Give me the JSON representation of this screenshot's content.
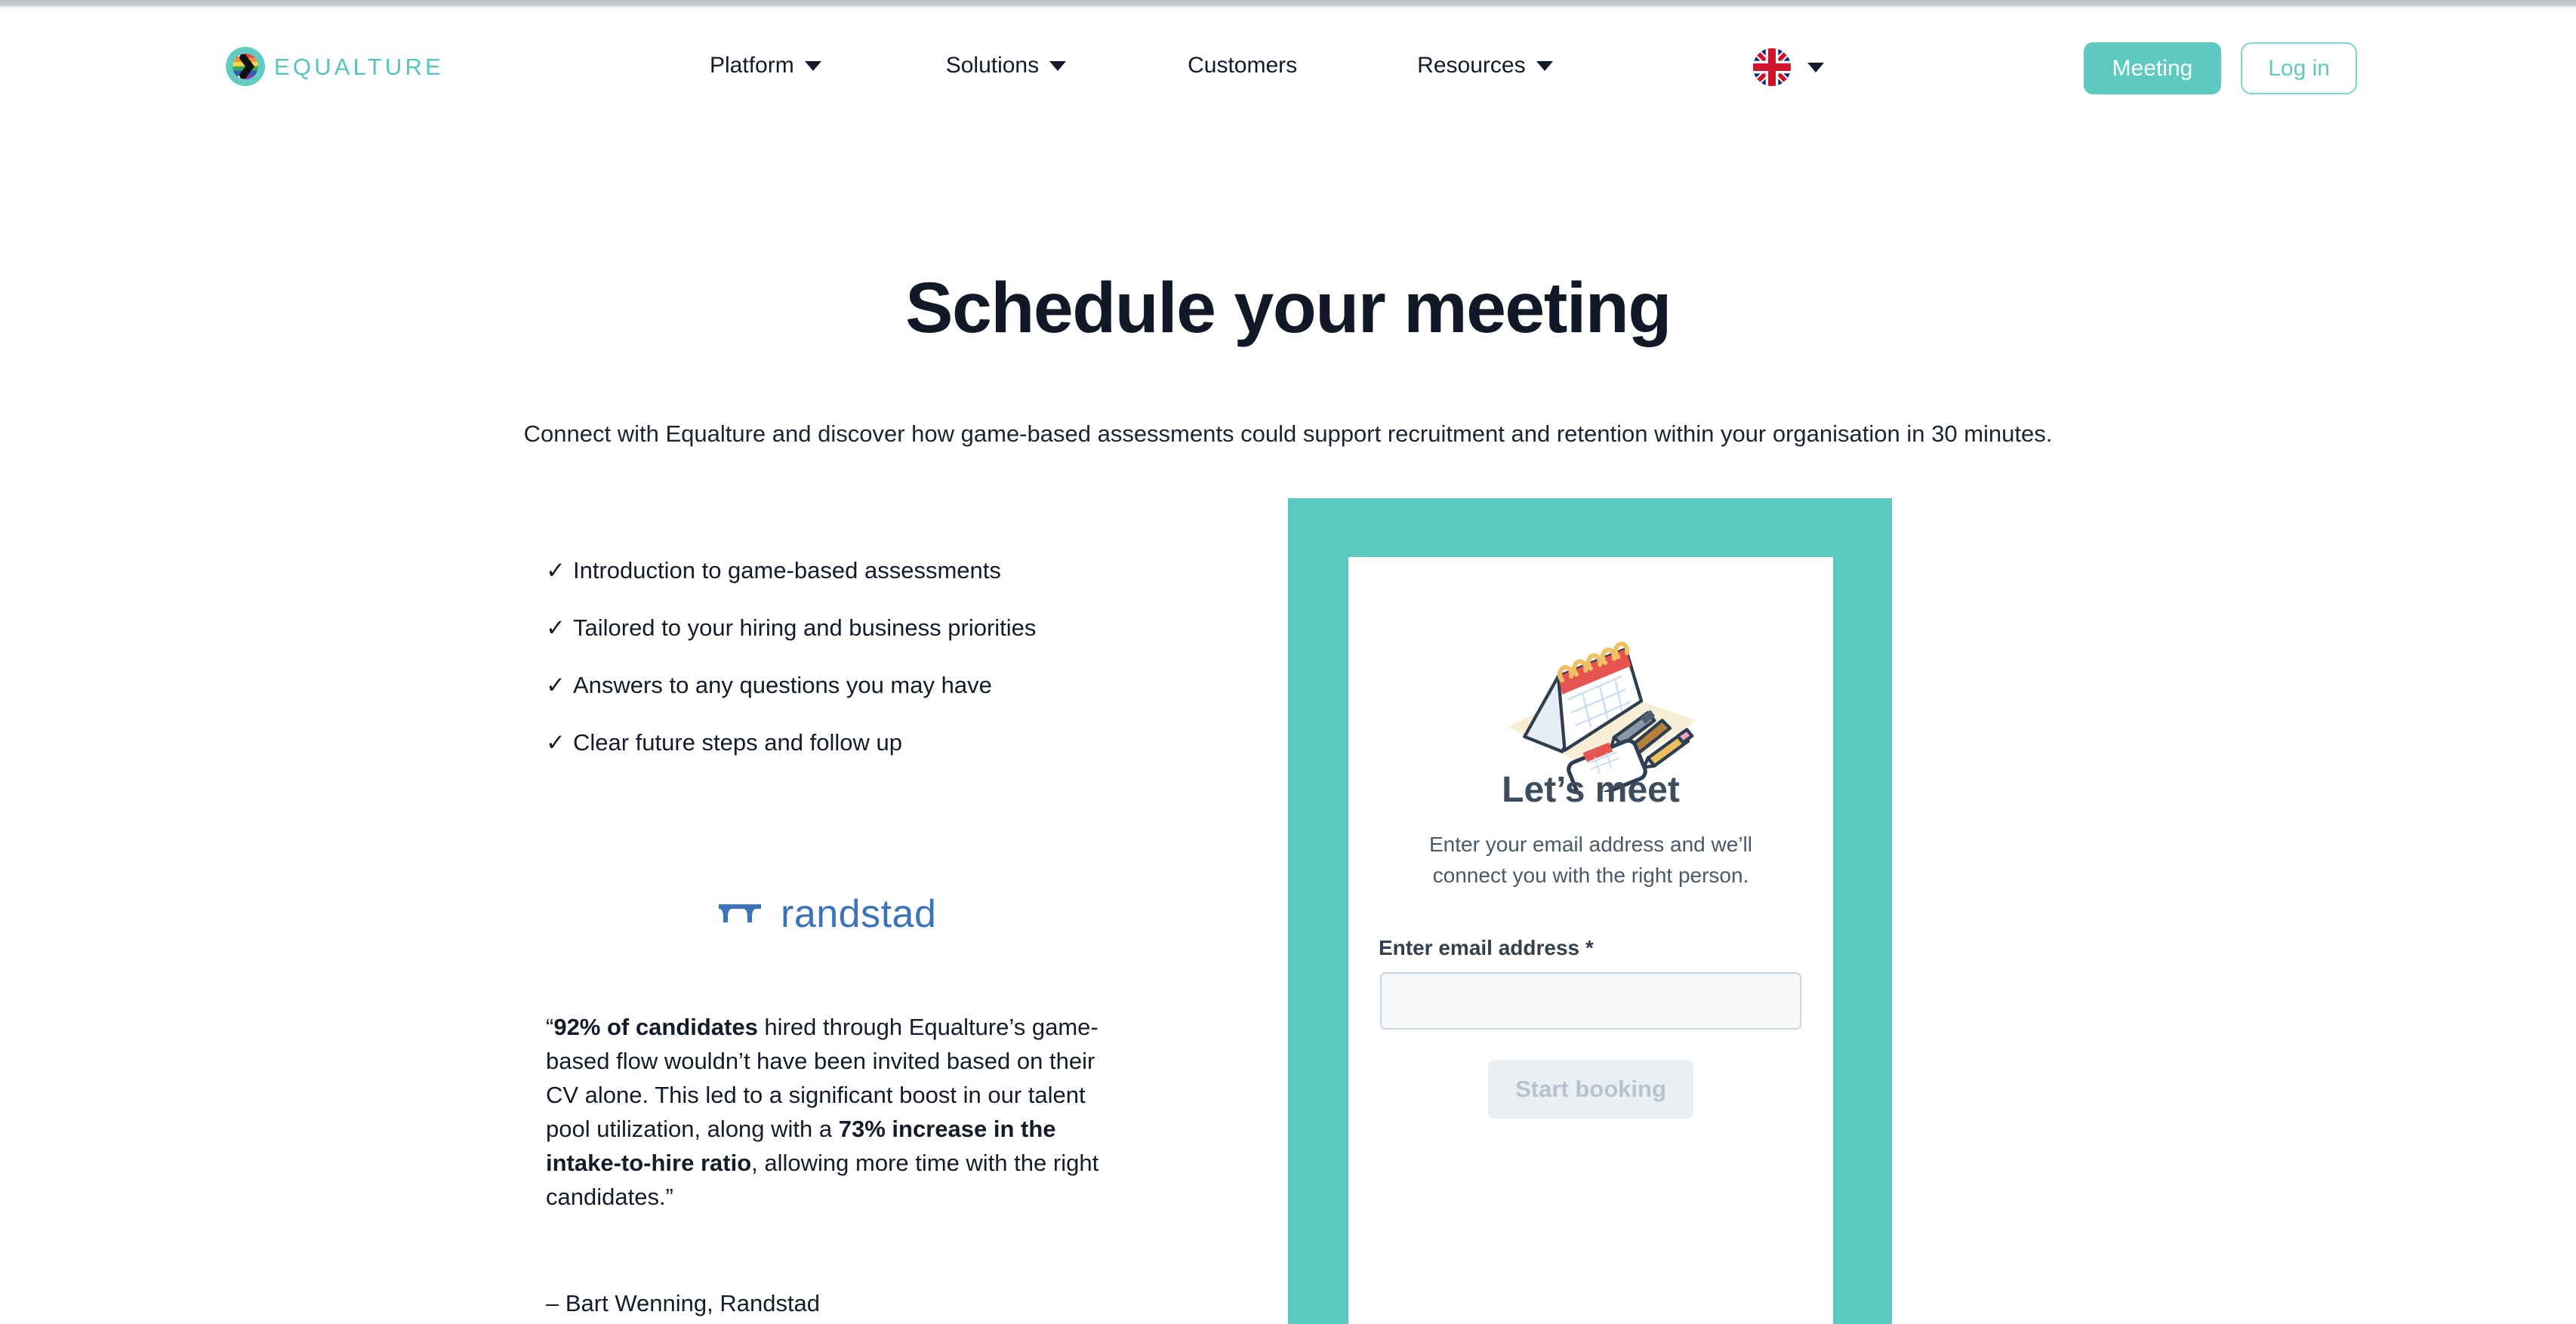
{
  "brand": {
    "name": "EQUALTURE",
    "logo_icon": "equalture-pride-chevron-icon",
    "teal": "#5BC9C0",
    "dark": "#111828"
  },
  "header": {
    "nav": [
      {
        "label": "Platform",
        "has_dropdown": true,
        "icon": "chevron-down-icon"
      },
      {
        "label": "Solutions",
        "has_dropdown": true,
        "icon": "chevron-down-icon"
      },
      {
        "label": "Customers",
        "has_dropdown": false,
        "icon": ""
      },
      {
        "label": "Resources",
        "has_dropdown": true,
        "icon": "chevron-down-icon"
      }
    ],
    "language": {
      "icon": "uk-flag-icon",
      "caret": "chevron-down-icon"
    },
    "meeting_label": "Meeting",
    "login_label": "Log in"
  },
  "hero": {
    "title": "Schedule your meeting",
    "subtitle": "Connect with Equalture and discover how game-based assessments could support recruitment and retention within your organisation in 30 minutes."
  },
  "benefits": {
    "check_glyph": "✓",
    "items": [
      "Introduction to game-based assessments",
      "Tailored to your hiring and business priorities",
      "Answers to any questions you may have",
      "Clear future steps and follow up"
    ]
  },
  "testimonial": {
    "company_logo": "randstad-logo-icon",
    "company_name": "randstad",
    "quote_part_1": "“",
    "quote_bold_1": "92% of candidates",
    "quote_part_2": " hired through Equalture’s game-based flow wouldn’t have been invited based on their CV alone. This led to a significant boost in our talent pool utilization, along with a ",
    "quote_bold_2": "73% increase in the intake-to-hire ratio",
    "quote_part_3": ", allowing more time with the right candidates.”",
    "author": "– Bart Wenning, Randstad"
  },
  "booking_card": {
    "illustration": "desk-calendar-pens-phone-illustration",
    "title": "Let’s meet",
    "subtitle": "Enter your email address and we’ll connect you with the right person.",
    "email_label": "Enter email address *",
    "email_value": "",
    "email_placeholder": "",
    "submit_label": "Start booking",
    "submit_disabled": true
  }
}
